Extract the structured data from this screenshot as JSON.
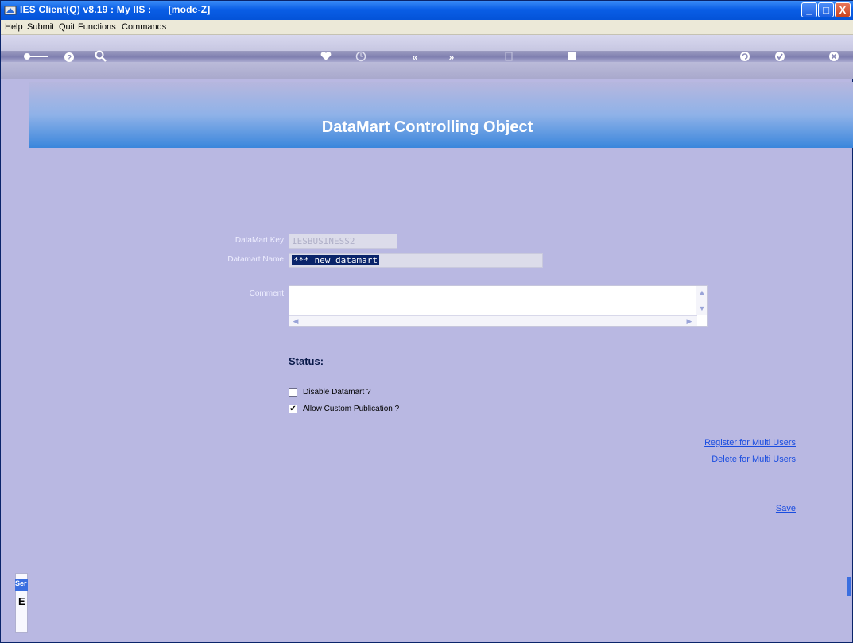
{
  "window": {
    "title": "IES Client(Q) v8.19 : My IIS :      [mode-Z]",
    "buttons": {
      "minimize": "_",
      "maximize": "□",
      "close": "X"
    }
  },
  "menu": [
    "Help",
    "Submit",
    "Quit",
    "Functions",
    "Commands"
  ],
  "toolbar": {
    "icons": [
      "key-icon",
      "help-icon",
      "search-icon",
      "heart-icon",
      "clock-icon",
      "rewind-icon",
      "forward-icon",
      "document-icon",
      "stop-icon",
      "refresh-icon",
      "check-icon",
      "close-icon"
    ],
    "glyphs": {
      "back": "«",
      "forward": "»",
      "check": "✓",
      "close": "×"
    }
  },
  "banner": {
    "title": "DataMart Controlling Object"
  },
  "form": {
    "datamart_key_label": "DataMart Key",
    "datamart_key_value": "IESBUSINESS2",
    "datamart_name_label": "Datamart Name",
    "datamart_name_value": "*** new datamart",
    "comment_label": "Comment",
    "comment_value": ""
  },
  "status": {
    "label": "Status:",
    "value": "-"
  },
  "checkboxes": [
    {
      "label": "Disable Datamart ?",
      "checked": false
    },
    {
      "label": "Allow Custom Publication ?",
      "checked": true
    }
  ],
  "links": {
    "register": "Register for Multi Users",
    "delete": "Delete for Multi Users",
    "save": "Save"
  },
  "side_panel": {
    "tab": "Ser",
    "letter": "E"
  },
  "colors": {
    "title_bar": "#0a5ee6",
    "background": "#b9b8e2",
    "link": "#1a4de0"
  }
}
